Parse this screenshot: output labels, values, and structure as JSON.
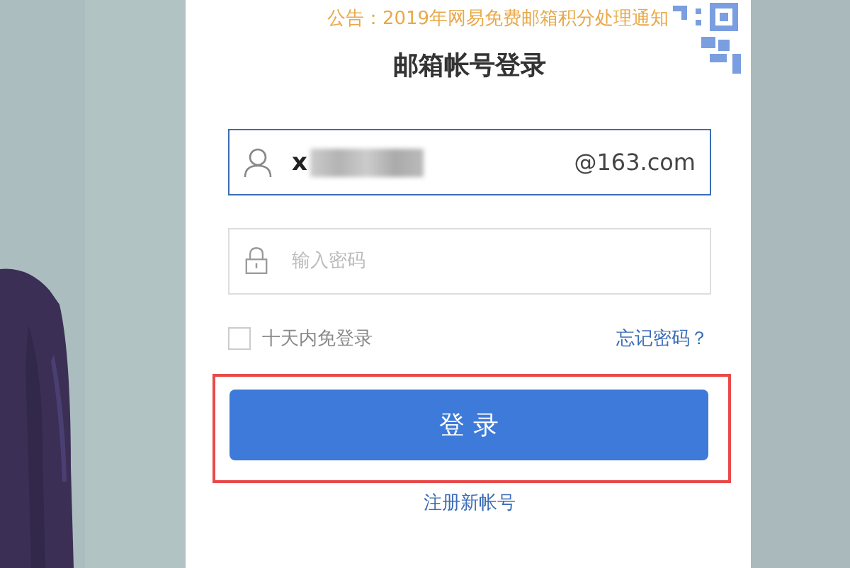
{
  "notice": "公告：2019年网易免费邮箱积分处理通知",
  "title": "邮箱帐号登录",
  "username": {
    "value": "x",
    "redacted": true,
    "suffix": "@163.com",
    "focused": true
  },
  "password": {
    "placeholder": "输入密码"
  },
  "remember": {
    "label": "十天内免登录",
    "checked": false
  },
  "forgot_link": "忘记密码？",
  "login_button": {
    "label": "登 录",
    "highlighted": true
  },
  "register_link": "注册新帐号"
}
